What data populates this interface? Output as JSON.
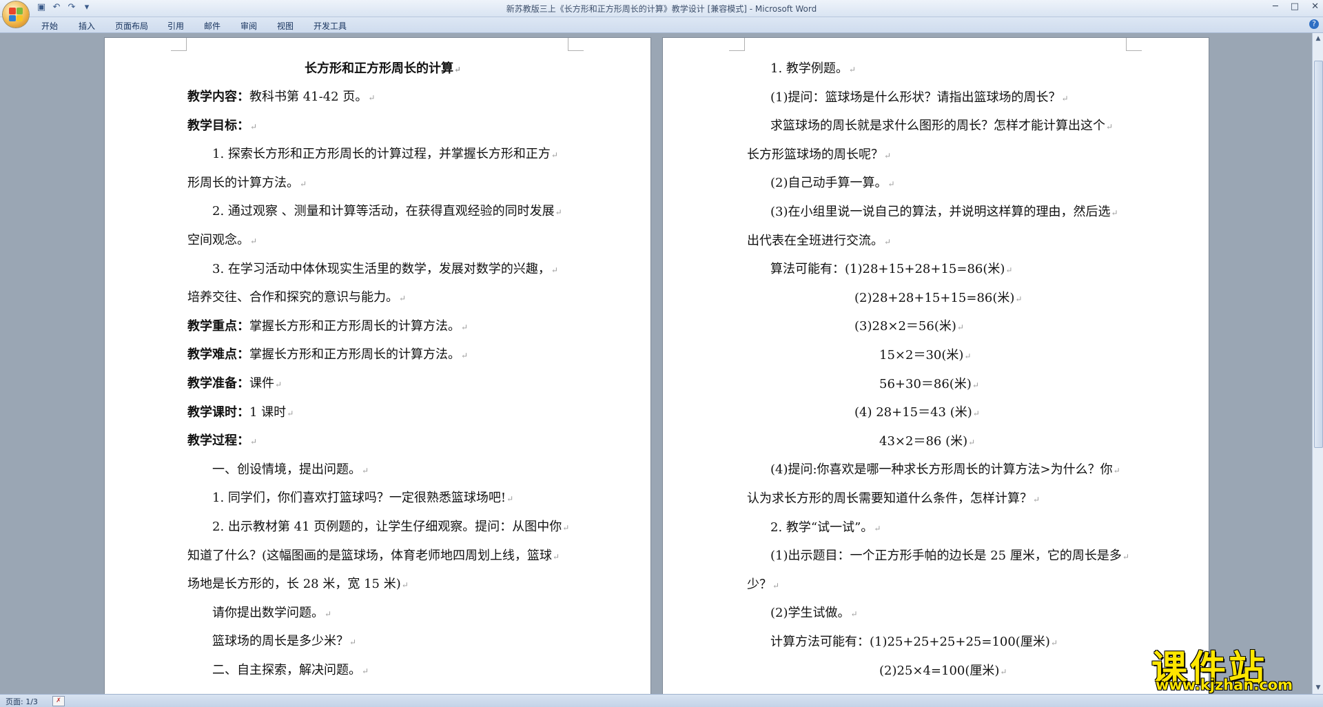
{
  "window": {
    "title": "新苏教版三上《长方形和正方形周长的计算》教学设计 [兼容模式] - Microsoft Word",
    "controls": {
      "minimize": "─",
      "maximize": "□",
      "close": "✕"
    }
  },
  "qat": {
    "save_icon": "save-icon",
    "undo": "↶",
    "redo": "↷",
    "customize": "▾"
  },
  "ribbon": {
    "tabs": [
      "开始",
      "插入",
      "页面布局",
      "引用",
      "邮件",
      "审阅",
      "视图",
      "开发工具"
    ],
    "help": "?"
  },
  "page1": {
    "title": "长方形和正方形周长的计算",
    "lines": [
      {
        "label": "教学内容：",
        "text": "教科书第 41-42 页。"
      },
      {
        "label": "教学目标：",
        "text": ""
      },
      {
        "label": "",
        "text": "1. 探索长方形和正方形周长的计算过程，并掌握长方形和正方"
      },
      {
        "label": "",
        "text": "形周长的计算方法。"
      },
      {
        "label": "",
        "text": "2. 通过观察 、测量和计算等活动，在获得直观经验的同时发展"
      },
      {
        "label": "",
        "text": "空间观念。"
      },
      {
        "label": "",
        "text": "3. 在学习活动中体休现实生活里的数学，发展对数学的兴趣，"
      },
      {
        "label": "",
        "text": "培养交往、合作和探究的意识与能力。"
      },
      {
        "label": "教学重点：",
        "text": "掌握长方形和正方形周长的计算方法。"
      },
      {
        "label": "教学难点：",
        "text": "掌握长方形和正方形周长的计算方法。"
      },
      {
        "label": "教学准备：",
        "text": "课件"
      },
      {
        "label": "教学课时：",
        "text": "1 课时"
      },
      {
        "label": "教学过程：",
        "text": ""
      },
      {
        "label": "",
        "text": "一、创设情境，提出问题。"
      },
      {
        "label": "",
        "text": "1. 同学们，你们喜欢打篮球吗？一定很熟悉篮球场吧!"
      },
      {
        "label": "",
        "text": "2. 出示教材第 41 页例题的，让学生仔细观察。提问：从图中你"
      },
      {
        "label": "",
        "text": "知道了什么？(这幅图画的是篮球场，体育老师地四周划上线，篮球"
      },
      {
        "label": "",
        "text": "场地是长方形的，长 28 米，宽 15 米)"
      },
      {
        "label": "",
        "text": "请你提出数学问题。"
      },
      {
        "label": "",
        "text": "篮球场的周长是多少米？"
      },
      {
        "label": "",
        "text": "二、自主探索，解决问题。"
      }
    ]
  },
  "page2": {
    "lines": [
      {
        "text": "1. 教学例题。"
      },
      {
        "text": "(1)提问：篮球场是什么形状？请指出篮球场的周长？"
      },
      {
        "text": "求篮球场的周长就是求什么图形的周长？怎样才能计算出这个"
      },
      {
        "text": "长方形篮球场的周长呢？"
      },
      {
        "text": "(2)自己动手算一算。"
      },
      {
        "text": "(3)在小组里说一说自己的算法，并说明这样算的理由，然后选"
      },
      {
        "text": "出代表在全班进行交流。"
      },
      {
        "text": "算法可能有：(1)28+15+28+15=86(米)"
      },
      {
        "text": "(2)28+28+15+15=86(米)"
      },
      {
        "text": "(3)28×2＝56(米)"
      },
      {
        "text": "15×2＝30(米)"
      },
      {
        "text": "56+30＝86(米)"
      },
      {
        "text": "(4) 28+15＝43 (米)"
      },
      {
        "text": "43×2＝86 (米)"
      },
      {
        "text": "(4)提问:你喜欢是哪一种求长方形周长的计算方法>为什么？你"
      },
      {
        "text": "认为求长方形的周长需要知道什么条件，怎样计算？"
      },
      {
        "text": "2. 教学“试一试”。"
      },
      {
        "text": "(1)出示题目：一个正方形手帕的边长是 25 厘米，它的周长是多"
      },
      {
        "text": "少？"
      },
      {
        "text": "(2)学生试做。"
      },
      {
        "text": "计算方法可能有：(1)25+25+25+25=100(厘米)"
      },
      {
        "text": "(2)25×4=100(厘米)"
      }
    ]
  },
  "paragraph_mark": "↵",
  "status": {
    "page": "页面: 1/3"
  },
  "watermark": {
    "cn": "课件站",
    "url": "www.kjzhan.com"
  }
}
